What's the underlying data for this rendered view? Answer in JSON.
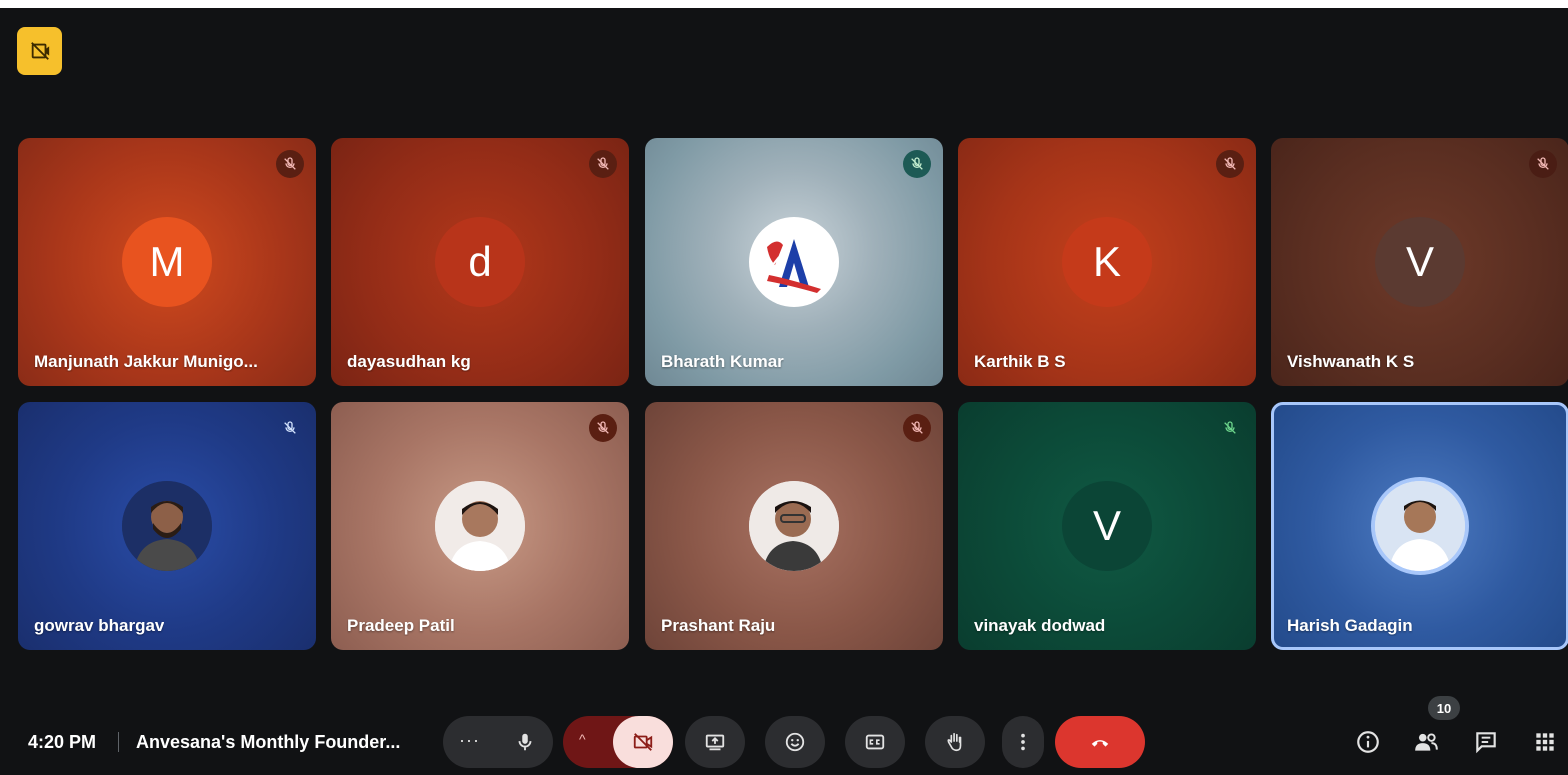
{
  "participants": [
    {
      "name": "Manjunath Jakkur Munigo...",
      "initial": "M",
      "avatar_color": "#e8531f",
      "muted_icon": "mic-off-icon"
    },
    {
      "name": "dayasudhan kg",
      "initial": "d",
      "avatar_color": "#b8341a",
      "muted_icon": "mic-off-icon"
    },
    {
      "name": "Bharath Kumar",
      "initial": "A",
      "avatar_color": "#ffffff",
      "muted_icon": "mic-off-icon"
    },
    {
      "name": "Karthik B S",
      "initial": "K",
      "avatar_color": "#c53a1a",
      "muted_icon": "mic-off-icon"
    },
    {
      "name": "Vishwanath K S",
      "initial": "V",
      "avatar_color": "#5b3a31",
      "muted_icon": "mic-off-icon"
    },
    {
      "name": "gowrav bhargav",
      "initial": "",
      "avatar_color": "#223a78",
      "muted_icon": "mic-off-icon"
    },
    {
      "name": "Pradeep Patil",
      "initial": "",
      "avatar_color": "#e8d6cf",
      "muted_icon": "mic-off-icon"
    },
    {
      "name": "Prashant Raju",
      "initial": "",
      "avatar_color": "#e8d6cf",
      "muted_icon": "mic-off-icon"
    },
    {
      "name": "vinayak dodwad",
      "initial": "V",
      "avatar_color": "#0b4536",
      "muted_icon": "mic-off-icon"
    },
    {
      "name": "Harish Gadagin",
      "initial": "",
      "avatar_color": "#dbe6f5",
      "muted_icon": ""
    }
  ],
  "footer": {
    "time": "4:20 PM",
    "meeting_title": "Anvesana's Monthly Founder...",
    "more_dots": "···",
    "chevron": "^",
    "participant_count": "10"
  },
  "icons": {
    "recording": "recording-off-icon",
    "mic": "mic-icon",
    "camera": "camera-off-icon",
    "present": "present-screen-icon",
    "emoji": "emoji-icon",
    "captions": "captions-icon",
    "hand": "raise-hand-icon",
    "more": "more-vert-icon",
    "leave": "call-end-icon",
    "info": "info-icon",
    "people": "people-icon",
    "chat": "chat-icon",
    "apps": "apps-grid-icon"
  },
  "colors": {
    "leave_red": "#dc362e",
    "cam_off_bg": "#f9dedc",
    "badge_yellow": "#f6c02c",
    "active_outline": "#a8c7fa"
  }
}
